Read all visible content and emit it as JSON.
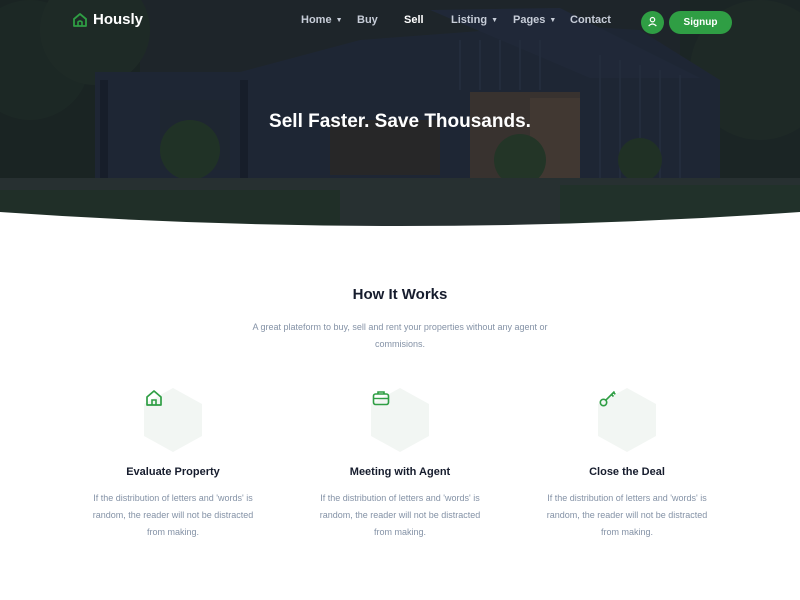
{
  "brand": {
    "name": "Hously",
    "accent": "#2f9e44"
  },
  "nav": {
    "items": [
      {
        "label": "Home",
        "has_dropdown": true,
        "active": false
      },
      {
        "label": "Buy",
        "has_dropdown": false,
        "active": false
      },
      {
        "label": "Sell",
        "has_dropdown": false,
        "active": true
      },
      {
        "label": "Listing",
        "has_dropdown": true,
        "active": false
      },
      {
        "label": "Pages",
        "has_dropdown": true,
        "active": false
      },
      {
        "label": "Contact",
        "has_dropdown": false,
        "active": false
      }
    ],
    "user_icon": "user-icon",
    "signup_label": "Signup"
  },
  "hero": {
    "title": "Sell Faster. Save Thousands."
  },
  "how": {
    "title": "How It Works",
    "subtitle": "A great plateform to buy, sell and rent your properties without any agent or commisions.",
    "steps": [
      {
        "icon": "home-icon",
        "title": "Evaluate Property",
        "text": "If the distribution of letters and 'words' is random, the reader will not be distracted from making."
      },
      {
        "icon": "briefcase-icon",
        "title": "Meeting with Agent",
        "text": "If the distribution of letters and 'words' is random, the reader will not be distracted from making."
      },
      {
        "icon": "key-icon",
        "title": "Close the Deal",
        "text": "If the distribution of letters and 'words' is random, the reader will not be distracted from making."
      }
    ]
  }
}
